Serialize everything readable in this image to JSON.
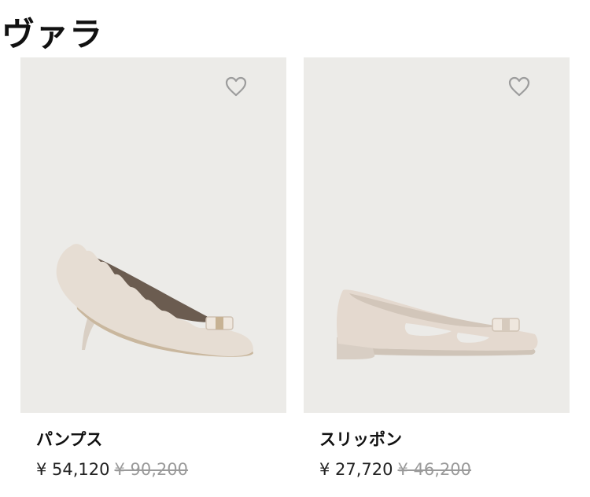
{
  "section": {
    "title": "ヴァラ"
  },
  "products": [
    {
      "name": "パンプス",
      "sale_price": "¥ 54,120",
      "original_price": "¥ 90,200",
      "wishlist_icon": "heart-outline-icon"
    },
    {
      "name": "スリッポン",
      "sale_price": "¥ 27,720",
      "original_price": "¥ 46,200",
      "wishlist_icon": "heart-outline-icon"
    }
  ],
  "colors": {
    "image_background": "#ecebe8",
    "shoe_body": "#e6ddd3",
    "price_original": "#9a9a9a",
    "heart_outline": "#9c9c9c"
  }
}
